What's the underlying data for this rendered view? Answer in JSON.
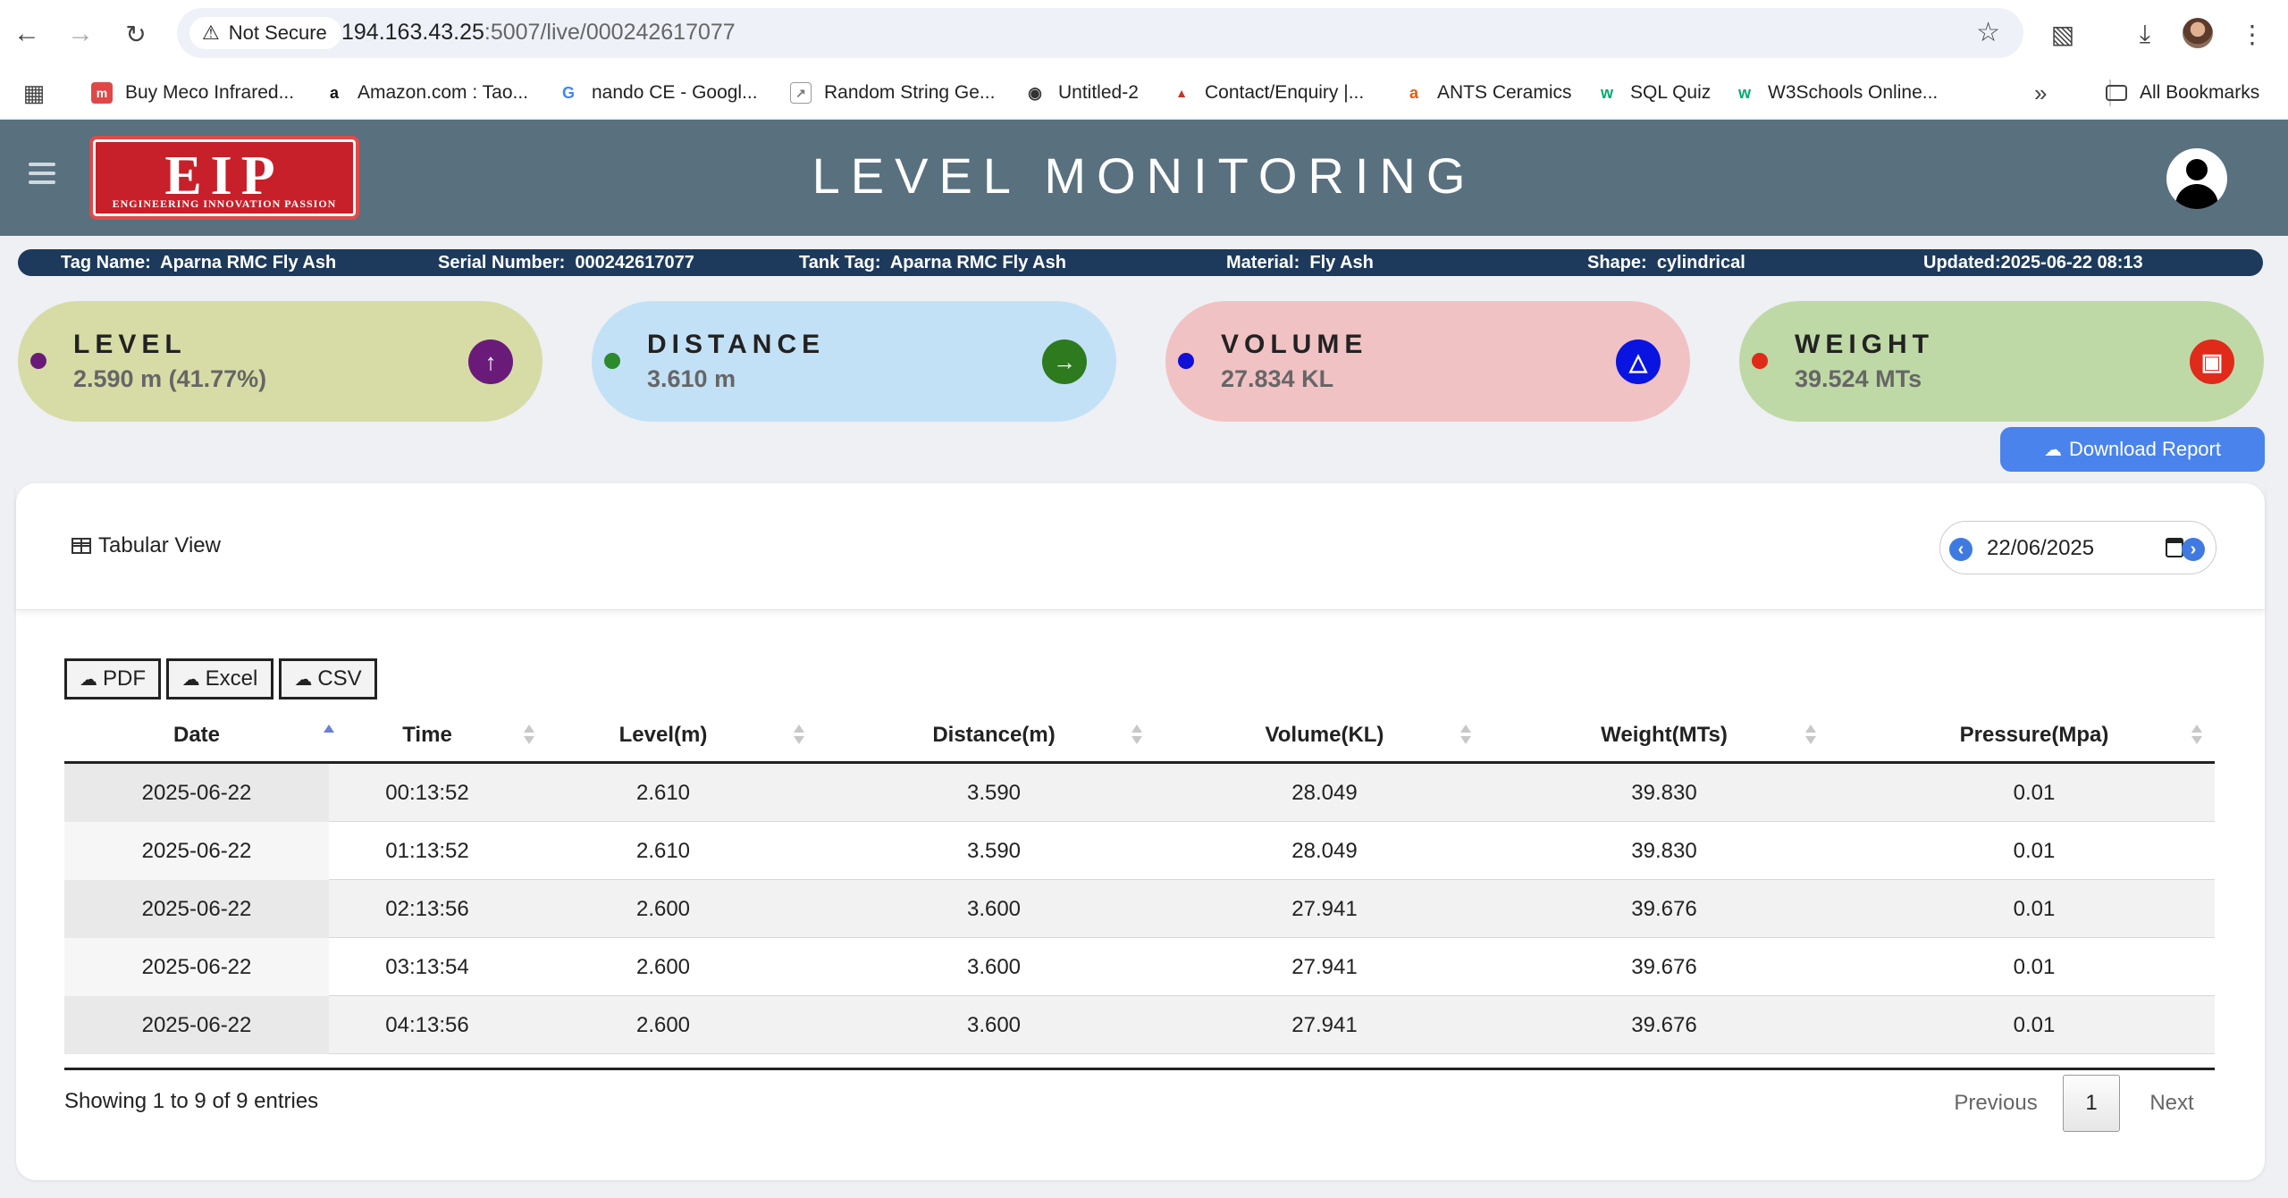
{
  "browser": {
    "security_label": "Not Secure",
    "url_host": "194.163.43.25",
    "url_path": ":5007/live/000242617077",
    "bookmarks": [
      {
        "label": "Buy Meco Infrared...",
        "icon": "meco-favicon",
        "color": "#e04848"
      },
      {
        "label": "Amazon.com : Tao...",
        "icon": "amazon-favicon",
        "color": "#111111"
      },
      {
        "label": "nando CE - Googl...",
        "icon": "google-favicon",
        "color": "#4285f4"
      },
      {
        "label": "Random String Ge...",
        "icon": "random-string-favicon",
        "color": "#777777"
      },
      {
        "label": "Untitled-2",
        "icon": "globe-favicon",
        "color": "#333333"
      },
      {
        "label": "Contact/Enquiry |...",
        "icon": "contact-favicon",
        "color": "#c0392b"
      },
      {
        "label": "ANTS Ceramics",
        "icon": "ants-favicon",
        "color": "#e8590c"
      },
      {
        "label": "SQL Quiz",
        "icon": "w3schools-favicon",
        "color": "#04aa6d"
      },
      {
        "label": "W3Schools Online...",
        "icon": "w3schools-favicon",
        "color": "#04aa6d"
      }
    ],
    "all_bookmarks_label": "All Bookmarks"
  },
  "header": {
    "logo_text": "EIP",
    "logo_tagline": "ENGINEERING INNOVATION PASSION",
    "title": "LEVEL MONITORING"
  },
  "info": {
    "tag_name_label": "Tag Name:",
    "tag_name": "Aparna RMC Fly Ash",
    "serial_label": "Serial Number:",
    "serial": "000242617077",
    "tank_tag_label": "Tank Tag:",
    "tank_tag": "Aparna RMC Fly Ash",
    "material_label": "Material:",
    "material": "Fly Ash",
    "shape_label": "Shape:",
    "shape": "cylindrical",
    "updated": "Updated:2025-06-22 08:13"
  },
  "cards": [
    {
      "label": "LEVEL",
      "value": "2.590 m (41.77%)",
      "bg": "#d7dca6",
      "dot": "#6a1b7a",
      "badge_color": "#6a1b7a",
      "icon": "arrow-up-icon"
    },
    {
      "label": "DISTANCE",
      "value": "3.610 m",
      "bg": "#c3e1f6",
      "dot": "#2d8a2d",
      "badge_color": "#2d7a1f",
      "icon": "arrow-right-icon"
    },
    {
      "label": "VOLUME",
      "value": "27.834 KL",
      "bg": "#f1c2c4",
      "dot": "#1010d8",
      "badge_color": "#0a14e0",
      "icon": "flask-icon"
    },
    {
      "label": "WEIGHT",
      "value": "39.524 MTs",
      "bg": "#bfd9a6",
      "dot": "#e02a1a",
      "badge_color": "#e02a1a",
      "icon": "weight-icon"
    }
  ],
  "download_label": "Download Report",
  "panel": {
    "tab_label": "Tabular View",
    "date_value": "22/06/2025",
    "export_buttons": [
      "PDF",
      "Excel",
      "CSV"
    ]
  },
  "table": {
    "columns": [
      "Date",
      "Time",
      "Level(m)",
      "Distance(m)",
      "Volume(KL)",
      "Weight(MTs)",
      "Pressure(Mpa)"
    ],
    "rows": [
      [
        "2025-06-22",
        "00:13:52",
        "2.610",
        "3.590",
        "28.049",
        "39.830",
        "0.01"
      ],
      [
        "2025-06-22",
        "01:13:52",
        "2.610",
        "3.590",
        "28.049",
        "39.830",
        "0.01"
      ],
      [
        "2025-06-22",
        "02:13:56",
        "2.600",
        "3.600",
        "27.941",
        "39.676",
        "0.01"
      ],
      [
        "2025-06-22",
        "03:13:54",
        "2.600",
        "3.600",
        "27.941",
        "39.676",
        "0.01"
      ],
      [
        "2025-06-22",
        "04:13:56",
        "2.600",
        "3.600",
        "27.941",
        "39.676",
        "0.01"
      ]
    ],
    "info": "Showing 1 to 9 of 9 entries",
    "pager": {
      "previous": "Previous",
      "current": "1",
      "next": "Next"
    }
  }
}
